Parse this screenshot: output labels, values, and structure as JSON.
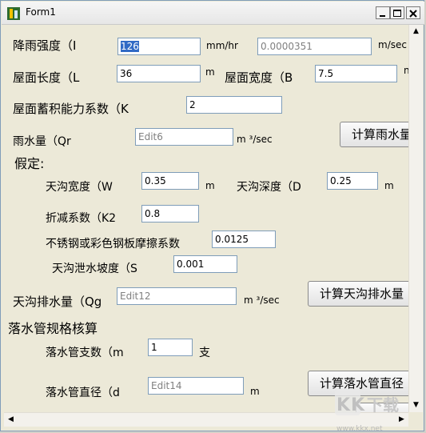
{
  "window": {
    "title": "Form1"
  },
  "rows": {
    "rainfall_label": "降雨强度（I",
    "rainfall_value": "126",
    "rainfall_unit": "mm/hr",
    "rainfall_result": "0.0000351",
    "rainfall_result_unit": "m/sec",
    "roof_length_label": "屋面长度（L",
    "roof_length_value": "36",
    "roof_length_unit": "m",
    "roof_width_label": "屋面宽度（B",
    "roof_width_value": "7.5",
    "roof_width_unit": "n",
    "storage_label": "屋面蓄积能力系数（K",
    "storage_value": "2",
    "rain_volume_label": "雨水量（Qr",
    "rain_volume_placeholder": "Edit6",
    "rain_volume_unit": "m ³/sec",
    "calc_rain_button": "计算雨水量",
    "assumption_label": "假定:",
    "gutter_width_label": "天沟宽度（W",
    "gutter_width_value": "0.35",
    "gutter_width_unit": "m",
    "gutter_depth_label": "天沟深度（D",
    "gutter_depth_value": "0.25",
    "gutter_depth_unit": "m",
    "reduction_label": "折减系数（K2",
    "reduction_value": "0.8",
    "friction_label": "不锈钢或彩色钢板摩擦系数",
    "friction_value": "0.0125",
    "slope_label": "天沟泄水坡度（S",
    "slope_value": "0.001",
    "gutter_drain_label": "天沟排水量（Qg",
    "gutter_drain_placeholder": "Edit12",
    "gutter_drain_unit": "m ³/sec",
    "calc_gutter_button": "计算天沟排水量",
    "downpipe_section_label": "落水管规格核算",
    "pipe_count_label": "落水管支数（m",
    "pipe_count_value": "1",
    "pipe_count_unit": "支",
    "pipe_diameter_label": "落水管直径（d",
    "pipe_diameter_placeholder": "Edit14",
    "pipe_diameter_unit": "m",
    "calc_pipe_button": "计算落水管直径",
    "watermark": "KK下载",
    "watermark_url": "www.kkx.net"
  },
  "colors": {
    "selection": "#316ac5",
    "window_bg": "#ece9d8",
    "border": "#7f9db9"
  },
  "icons": [
    "app-icon",
    "minimize-icon",
    "maximize-icon",
    "close-icon",
    "scroll-up-icon",
    "scroll-down-icon",
    "scroll-left-icon",
    "scroll-right-icon"
  ]
}
